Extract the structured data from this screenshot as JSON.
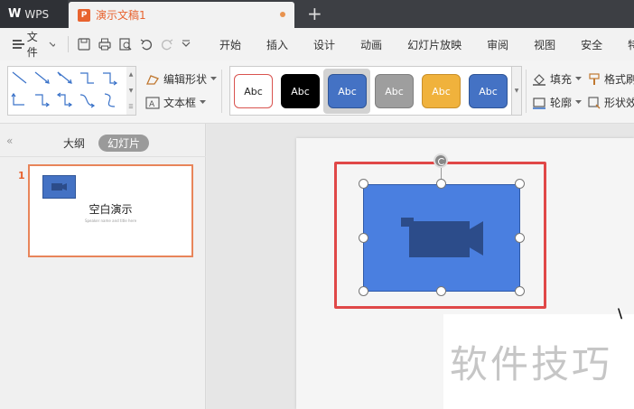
{
  "titlebar": {
    "app_name": "WPS",
    "doc_tab": "演示文稿1",
    "new_tab": "+"
  },
  "menubar": {
    "file_label": "文件",
    "tabs": [
      "开始",
      "插入",
      "设计",
      "动画",
      "幻灯片放映",
      "审阅",
      "视图",
      "安全",
      "特"
    ]
  },
  "toolbar": {
    "edit_shape": "编辑形状",
    "text_box": "文本框",
    "fill": "填充",
    "outline": "轮廓",
    "format_painter": "格式刷",
    "shape_effects": "形状效",
    "style_samples": [
      {
        "label": "Abc",
        "bg": "#ffffff",
        "fg": "#222222",
        "border": "#d9534f"
      },
      {
        "label": "Abc",
        "bg": "#000000",
        "fg": "#ffffff",
        "border": "#000000"
      },
      {
        "label": "Abc",
        "bg": "#4472c4",
        "fg": "#ffffff",
        "border": "#2f5597"
      },
      {
        "label": "Abc",
        "bg": "#9e9e9e",
        "fg": "#ffffff",
        "border": "#7f7f7f"
      },
      {
        "label": "Abc",
        "bg": "#f0b23c",
        "fg": "#ffffff",
        "border": "#c9902a"
      },
      {
        "label": "Abc",
        "bg": "#4472c4",
        "fg": "#ffffff",
        "border": "#2f5597"
      }
    ]
  },
  "leftpanel": {
    "tab_outline": "大纲",
    "tab_slides": "幻灯片",
    "slide_number": "1",
    "thumb_title": "空白演示",
    "thumb_subtitle": "Speaker name and title here"
  },
  "canvas": {
    "shape_icon": "video-camera-icon",
    "watermark": "软件技巧"
  },
  "colors": {
    "accent_orange": "#e8632f",
    "shape_blue": "#4a7fe0",
    "highlight_red": "#e04848"
  }
}
